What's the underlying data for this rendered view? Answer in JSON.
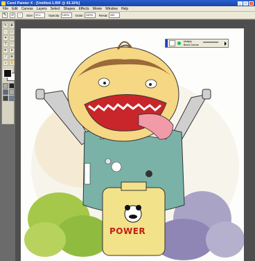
{
  "titlebar": {
    "title": "Corel Painter X - [Untitled-1.RIF @ 43.16%]"
  },
  "window_buttons": {
    "minimize": "_",
    "maximize": "□",
    "close": "×"
  },
  "menu": [
    "File",
    "Edit",
    "Canvas",
    "Layers",
    "Select",
    "Shapes",
    "Effects",
    "Movie",
    "Window",
    "Help"
  ],
  "property_bar": {
    "size_label": "Size:",
    "size_value": "23.1",
    "opacity_label": "Opacity:",
    "opacity_value": "100%",
    "grain_label": "Grain:",
    "grain_value": "100%",
    "blend_label": "Resat:",
    "blend_value": "100"
  },
  "layers_panel": {
    "composite_method": "Multiply",
    "layer_name": "Blood Canvas"
  },
  "artwork": {
    "label_text": "POWER"
  },
  "colors": {
    "titlebar": "#2a5fd1",
    "ui_gray": "#ece9d8",
    "canvas_bg": "#4e4e4e",
    "power_red": "#c21d12"
  }
}
